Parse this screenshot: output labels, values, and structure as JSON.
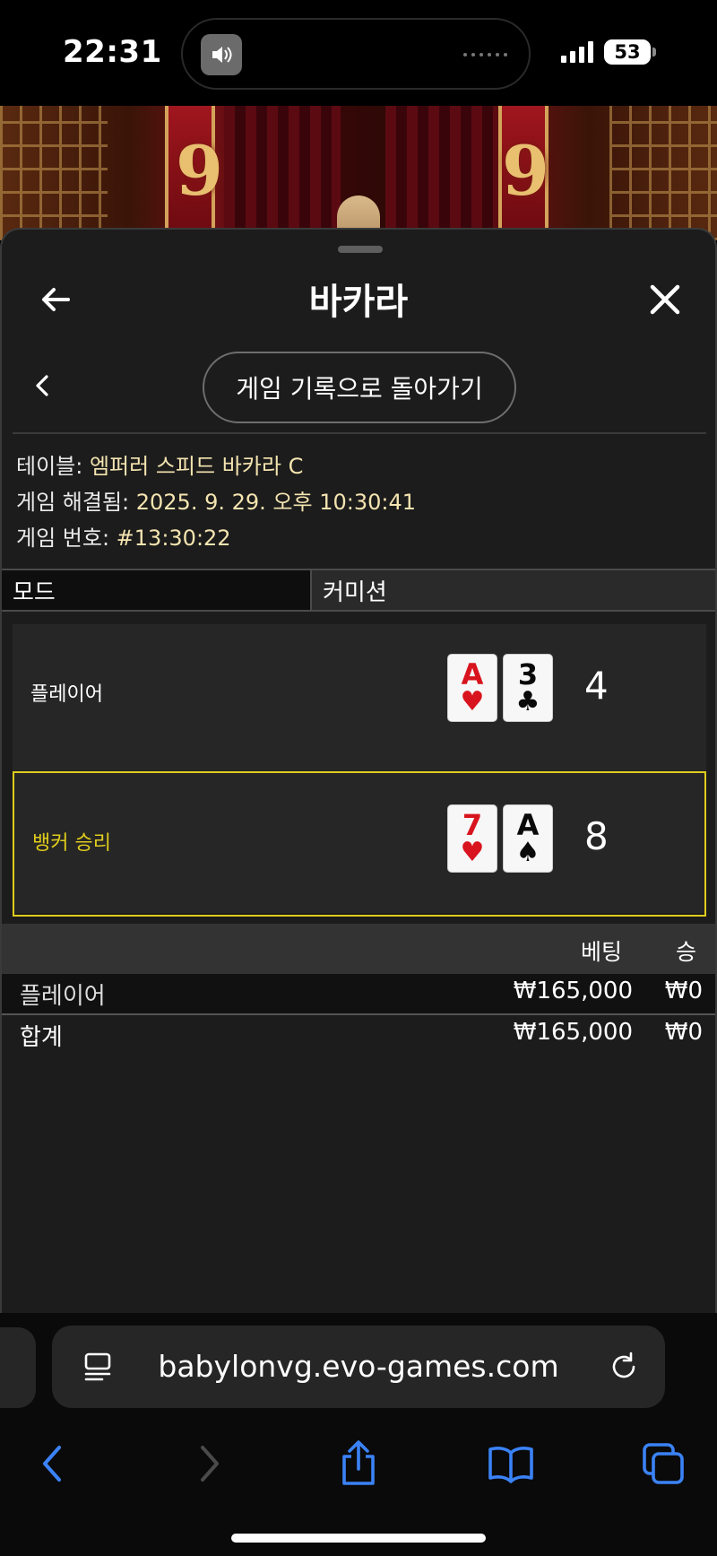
{
  "status_bar": {
    "time": "22:31",
    "battery": "53",
    "icons": [
      "speaker-icon",
      "signal-icon",
      "battery-icon"
    ]
  },
  "header": {
    "title": "바카라",
    "back_icon": "arrow-left-icon",
    "close_icon": "close-icon"
  },
  "subnav": {
    "back_label": "게임 기록으로 돌아가기",
    "chevron_icon": "chevron-left-icon"
  },
  "info": {
    "table_key": "테이블: ",
    "table_value": "엠퍼러 스피드 바카라 C",
    "resolved_key": "게임 해결됨: ",
    "resolved_value": "2025. 9. 29. 오후 10:30:41",
    "number_key": "게임 번호: ",
    "number_value": "#13:30:22"
  },
  "tabs": [
    {
      "label": "모드",
      "active": true
    },
    {
      "label": "커미션",
      "active": false
    }
  ],
  "hands": [
    {
      "label": "플레이어",
      "winner": false,
      "cards": [
        {
          "rank": "A",
          "suit": "♥",
          "color": "red"
        },
        {
          "rank": "3",
          "suit": "♣",
          "color": "black"
        }
      ],
      "score": "4"
    },
    {
      "label": "뱅커 승리",
      "winner": true,
      "cards": [
        {
          "rank": "7",
          "suit": "♥",
          "color": "red"
        },
        {
          "rank": "A",
          "suit": "♠",
          "color": "black"
        }
      ],
      "score": "8"
    }
  ],
  "bets": {
    "headers": {
      "bet": "베팅",
      "win": "승"
    },
    "rows": [
      {
        "name": "플레이어",
        "bet": "₩165,000",
        "win": "₩0"
      }
    ],
    "total": {
      "name": "합계",
      "bet": "₩165,000",
      "win": "₩0"
    }
  },
  "browser": {
    "url": "babylonvg.evo-games.com",
    "icons": [
      "reader-icon",
      "reload-icon",
      "back-icon",
      "forward-icon",
      "share-icon",
      "bookmarks-icon",
      "tabs-icon"
    ]
  },
  "colors": {
    "accent_yellow": "#e0cc1c",
    "info_value": "#f4e4b0",
    "safari_blue": "#3b82f6",
    "sheet_bg": "#1c1c1c"
  }
}
